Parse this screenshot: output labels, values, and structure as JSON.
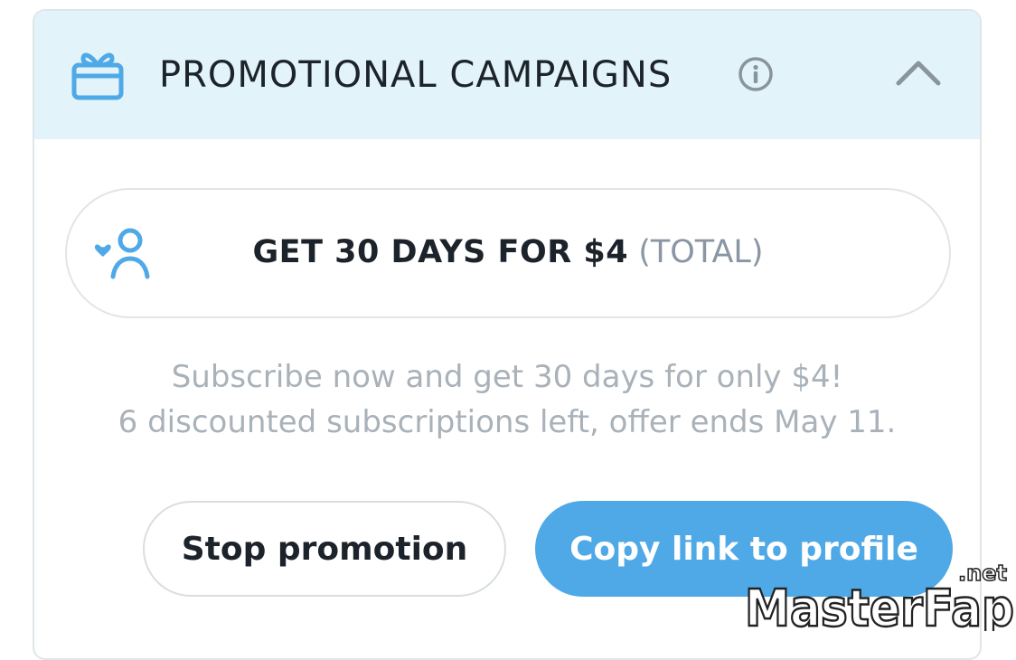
{
  "header": {
    "title": "PROMOTIONAL CAMPAIGNS",
    "icon": "gift-icon",
    "info_icon": "info-icon",
    "collapse_icon": "chevron-up-icon"
  },
  "offer": {
    "icon": "subscriber-heart-icon",
    "main_text": "GET 30 DAYS FOR $4",
    "suffix_text": "(TOTAL)"
  },
  "description": {
    "line1": "Subscribe now and get 30 days for only $4!",
    "line2": "6 discounted subscriptions left, offer ends May 11."
  },
  "buttons": {
    "stop_label": "Stop promotion",
    "copy_label": "Copy link to profile"
  },
  "watermark": {
    "brand": "MasterFap",
    "tld": ".net"
  },
  "colors": {
    "accent": "#4fa9e6",
    "header_bg": "#e3f3fa",
    "text_dark": "#1c232b",
    "text_muted": "#a9b1b9"
  }
}
